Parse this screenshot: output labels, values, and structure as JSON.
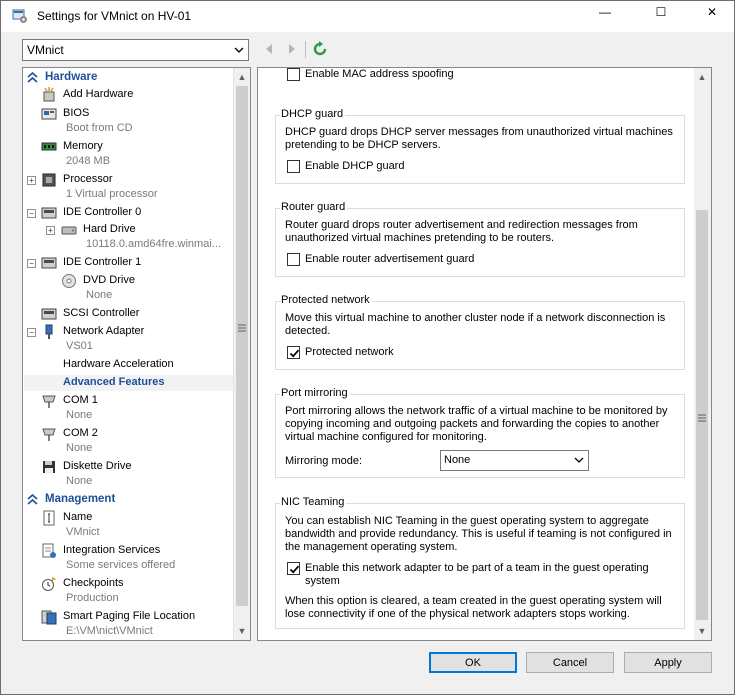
{
  "window": {
    "title": "Settings for VMnict on HV-01",
    "minimize_glyph": "—",
    "maximize_glyph": "☐",
    "close_glyph": "✕",
    "icon": "settings-window-icon"
  },
  "toolbar": {
    "vm_select_value": "VMnict",
    "back_icon": "back-arrow-icon",
    "forward_icon": "forward-arrow-icon",
    "refresh_icon": "refresh-icon"
  },
  "tree": {
    "hardware_header": "Hardware",
    "management_header": "Management",
    "hardware_items": [
      {
        "label": "Add Hardware",
        "icon": "add-hardware-icon"
      },
      {
        "label": "BIOS",
        "sub": "Boot from CD",
        "icon": "bios-icon"
      },
      {
        "label": "Memory",
        "sub": "2048 MB",
        "icon": "memory-icon"
      },
      {
        "label": "Processor",
        "sub": "1 Virtual processor",
        "icon": "processor-icon"
      },
      {
        "label": "IDE Controller 0",
        "icon": "ide-controller-icon"
      },
      {
        "label": "Hard Drive",
        "sub": "10118.0.amd64fre.winmai...",
        "icon": "hard-drive-icon"
      },
      {
        "label": "IDE Controller 1",
        "icon": "ide-controller-icon"
      },
      {
        "label": "DVD Drive",
        "sub": "None",
        "icon": "dvd-drive-icon"
      },
      {
        "label": "SCSI Controller",
        "icon": "scsi-controller-icon"
      },
      {
        "label": "Network Adapter",
        "sub": "VS01",
        "icon": "network-adapter-icon"
      },
      {
        "label": "Hardware Acceleration"
      },
      {
        "label": "Advanced Features"
      },
      {
        "label": "COM 1",
        "sub": "None",
        "icon": "com-port-icon"
      },
      {
        "label": "COM 2",
        "sub": "None",
        "icon": "com-port-icon"
      },
      {
        "label": "Diskette Drive",
        "sub": "None",
        "icon": "diskette-icon"
      }
    ],
    "management_items": [
      {
        "label": "Name",
        "sub": "VMnict",
        "icon": "name-icon"
      },
      {
        "label": "Integration Services",
        "sub": "Some services offered",
        "icon": "integration-services-icon"
      },
      {
        "label": "Checkpoints",
        "sub": "Production",
        "icon": "checkpoints-icon"
      },
      {
        "label": "Smart Paging File Location",
        "sub": "E:\\VM\\nict\\VMnict",
        "icon": "smart-paging-icon"
      }
    ]
  },
  "details": {
    "mac_spoofing_label": "Enable MAC address spoofing",
    "mac_spoofing_checked": false,
    "dhcp": {
      "title": "DHCP guard",
      "desc": "DHCP guard drops DHCP server messages from unauthorized virtual machines pretending to be DHCP servers.",
      "check_label": "Enable DHCP guard",
      "checked": false
    },
    "router": {
      "title": "Router guard",
      "desc": "Router guard drops router advertisement and redirection messages from unauthorized virtual machines pretending to be routers.",
      "check_label": "Enable router advertisement guard",
      "checked": false
    },
    "protected": {
      "title": "Protected network",
      "desc": "Move this virtual machine to another cluster node if a network disconnection is detected.",
      "check_label": "Protected network",
      "checked": true
    },
    "mirroring": {
      "title": "Port mirroring",
      "desc": "Port mirroring allows the network traffic of a virtual machine to be monitored by copying incoming and outgoing packets and forwarding the copies to another virtual machine configured for monitoring.",
      "mode_label": "Mirroring mode:",
      "mode_value": "None"
    },
    "teaming": {
      "title": "NIC Teaming",
      "desc": "You can establish NIC Teaming in the guest operating system to aggregate bandwidth and provide redundancy. This is useful if teaming is not configured in the management operating system.",
      "check_label": "Enable this network adapter to be part of a team in the guest operating system",
      "checked": true,
      "note": "When this option is cleared, a team created in the guest operating system will lose connectivity if one of the physical network adapters stops working."
    }
  },
  "buttons": {
    "ok": "OK",
    "cancel": "Cancel",
    "apply": "Apply"
  },
  "colors": {
    "accent": "#1e4f99",
    "focus": "#0078d7"
  }
}
